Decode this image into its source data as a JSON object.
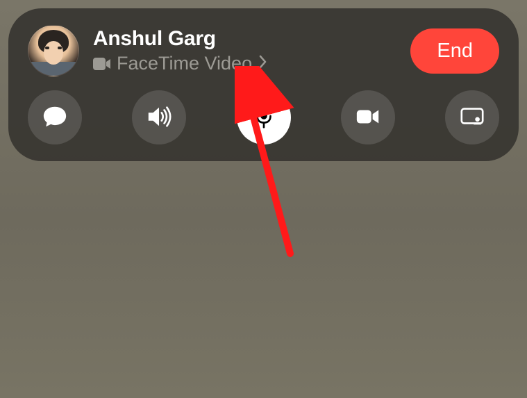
{
  "header": {
    "contact_name": "Anshul Garg",
    "call_type": "FaceTime Video",
    "end_label": "End"
  },
  "controls": {
    "messages": "messages",
    "speaker": "speaker",
    "mute": "mute",
    "video": "video",
    "shareplay": "shareplay"
  },
  "colors": {
    "end_button": "#ff453a",
    "panel_bg": "rgba(55, 53, 49, 0.92)",
    "annotation_arrow": "#ff1a1a"
  }
}
